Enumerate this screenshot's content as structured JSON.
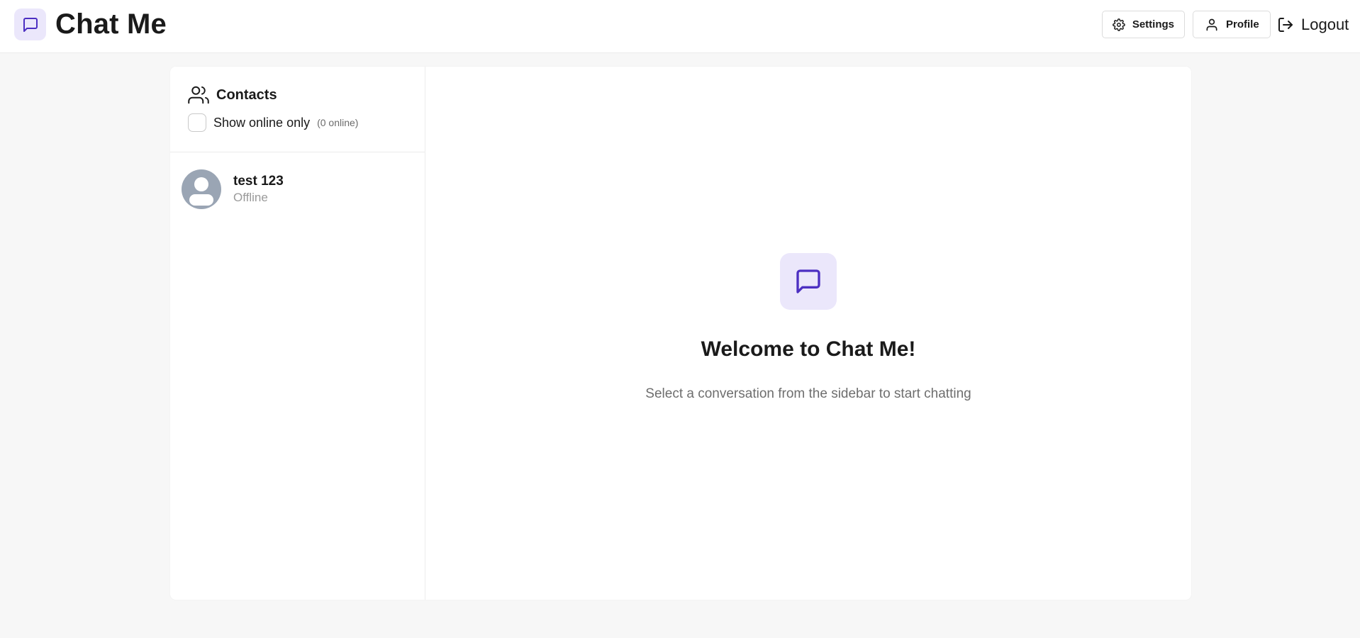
{
  "app": {
    "title": "Chat Me",
    "accent_color": "#4c2fc2",
    "badge_bg": "#ebe7fb"
  },
  "header": {
    "settings_label": "Settings",
    "profile_label": "Profile",
    "logout_label": "Logout",
    "icons": {
      "brand": "message-square-icon",
      "settings": "gear-icon",
      "profile": "user-icon",
      "logout": "log-out-icon"
    }
  },
  "sidebar": {
    "title": "Contacts",
    "title_icon": "users-icon",
    "filter": {
      "label": "Show online only",
      "checked": false,
      "online_count_text": "(0 online)"
    },
    "contacts": [
      {
        "name": "test 123",
        "status": "Offline",
        "avatar": "default-avatar-icon"
      }
    ]
  },
  "main": {
    "welcome_icon": "message-square-icon",
    "welcome_title": "Welcome to Chat Me!",
    "welcome_subtitle": "Select a conversation from the sidebar to start chatting"
  }
}
